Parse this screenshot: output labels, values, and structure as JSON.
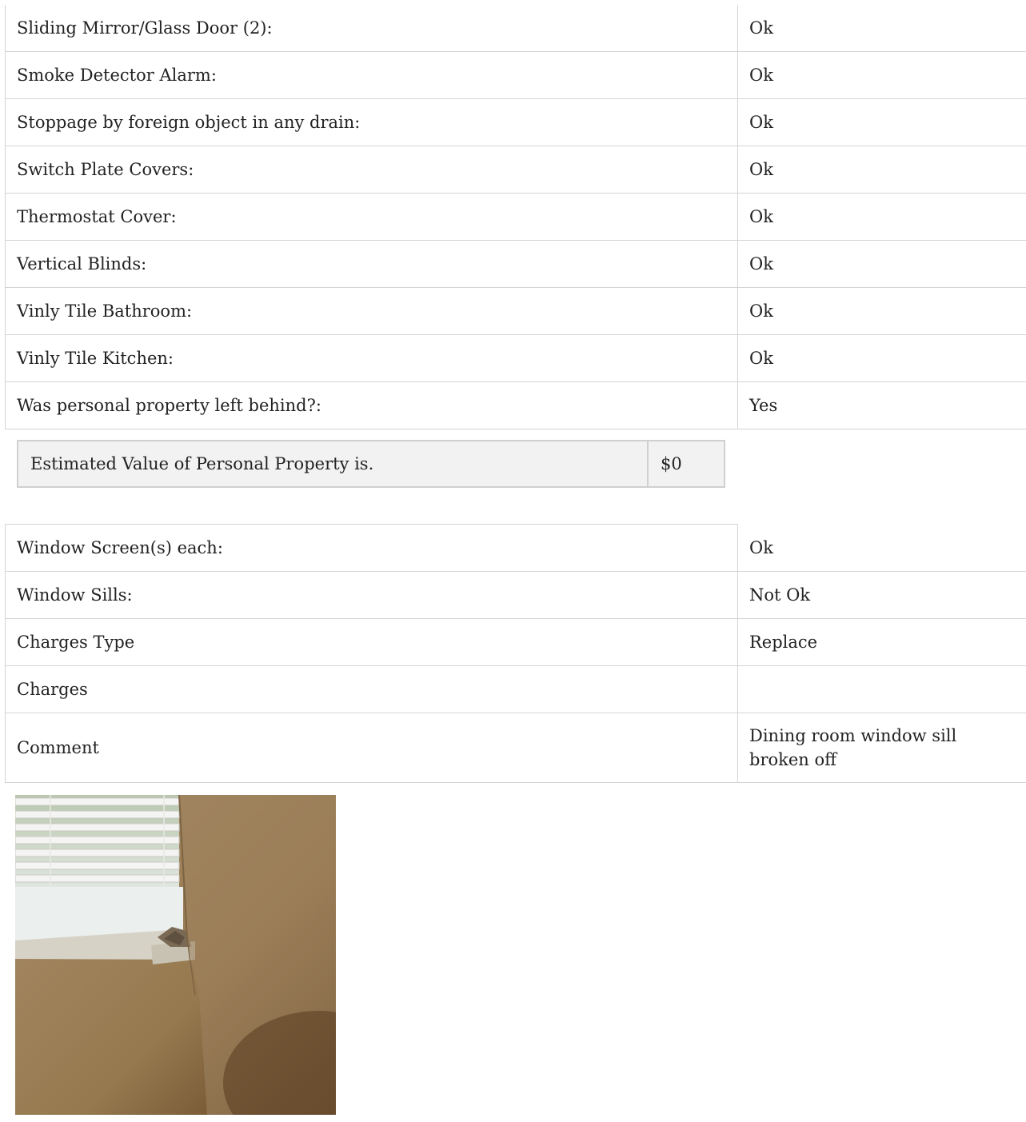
{
  "checklist": [
    {
      "label": "Sliding Mirror/Glass Door (2):",
      "value": "Ok"
    },
    {
      "label": "Smoke Detector Alarm:",
      "value": "Ok"
    },
    {
      "label": "Stoppage by foreign object in any drain:",
      "value": "Ok"
    },
    {
      "label": "Switch Plate Covers:",
      "value": "Ok"
    },
    {
      "label": "Thermostat Cover:",
      "value": "Ok"
    },
    {
      "label": "Vertical Blinds:",
      "value": "Ok"
    },
    {
      "label": "Vinly Tile Bathroom:",
      "value": "Ok"
    },
    {
      "label": "Vinly Tile Kitchen:",
      "value": "Ok"
    },
    {
      "label": "Was personal property left behind?:",
      "value": "Yes"
    }
  ],
  "personal_property": {
    "label": "Estimated Value of Personal Property is.",
    "value": "$0"
  },
  "checklist_lower": [
    {
      "label": "Window Screen(s) each:",
      "value": "Ok"
    },
    {
      "label": "Window Sills:",
      "value": "Not Ok"
    },
    {
      "label": "Charges Type",
      "value": "Replace"
    },
    {
      "label": "Charges",
      "value": ""
    },
    {
      "label": "Comment",
      "value": "Dining room window sill broken off"
    }
  ],
  "photo": {
    "icon": "window-sill-damage-photo"
  }
}
